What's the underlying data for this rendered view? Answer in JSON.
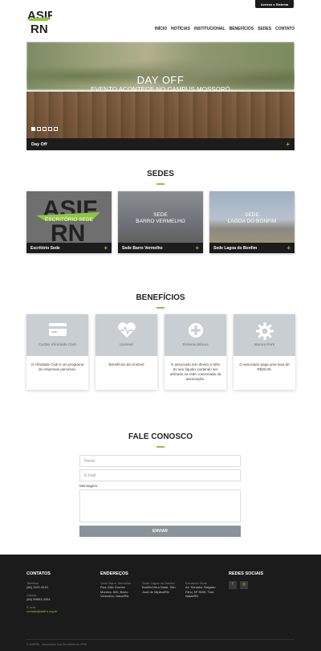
{
  "header": {
    "access_button": "Acesso o Sistema",
    "logo_text_top": "ASIF",
    "logo_text_bottom": "RN",
    "nav": [
      "INÍCIO",
      "NOTÍCIAS",
      "INSTITUCIONAL",
      "BENEFÍCIOS",
      "SEDES",
      "CONTATO"
    ]
  },
  "hero": {
    "title": "DAY OFF",
    "subtitle": "EVENTO ACONTECE NO CAMPUS MOSSORÓ",
    "caption": "Day Off",
    "slides_total": 5,
    "active_slide": 1
  },
  "sedes": {
    "heading": "SEDES",
    "items": [
      {
        "overlay": "ESCRITÓRIO SEDE",
        "name": "Escritório Sede"
      },
      {
        "overlay": "SEDE\nBARRO VERMELHO",
        "name": "Sede Barro Vermelho"
      },
      {
        "overlay": "SEDE\nLAGOA DO BONFIM",
        "name": "Sede Lagoa do Bonfim"
      }
    ]
  },
  "beneficios": {
    "heading": "BENEFÍCIOS",
    "items": [
      {
        "name": "Cartão Afinidade Club",
        "desc": "O Afinidade Club é um programa de empresas parceiras.",
        "icon": "credit-card-icon"
      },
      {
        "name": "Unimed",
        "desc": "Benefícios da Unimed",
        "icon": "heart-pulse-icon"
      },
      {
        "name": "Sistema Bônus",
        "desc": "O associado tem direito a 30% do seu líquido, podendo ser utilizado na rede conveniada da associação.",
        "icon": "plus-circle-icon"
      },
      {
        "name": "Manoa Park",
        "desc": "O associado paga uma taxa de R$30,00.",
        "icon": "gear-icon"
      }
    ]
  },
  "contact": {
    "heading": "FALE CONOSCO",
    "name_placeholder": "Nome",
    "email_placeholder": "E-mail",
    "message_label": "Mensagem",
    "send_label": "ENVIAR"
  },
  "footer": {
    "contatos": {
      "heading": "CONTATOS",
      "tel_label": "Telefone",
      "tel": "(84) 3221-6101",
      "cel_label": "Celular",
      "cel": "(84) 99663-4354",
      "email_label": "E-mail",
      "email": "contato@asifrn.org.br"
    },
    "enderecos": {
      "heading": "ENDEREÇOS",
      "col1_label": "Sede Barro Vermelho",
      "col1": "Rua Júlio Gomes Moreira, 820, Barro Vermelho, Natal/RN",
      "col2_label": "Sede Lagoa do Bonfim",
      "col2": "Bonfim/Vera Natal, São José de Mipibu/RN",
      "col3_label": "Escritório Sede",
      "col3": "Av. Senador Salgado Filho, Nº 3000, Tirol, Natal/RN"
    },
    "social": {
      "heading": "REDES SOCIAIS",
      "icons": [
        "facebook-icon",
        "instagram-icon"
      ]
    },
    "copyright": "© ASIFRN - Associação dos Servidores do IFRN"
  },
  "colors": {
    "accent": "#8cc63f",
    "dark": "#1b1b1b"
  }
}
